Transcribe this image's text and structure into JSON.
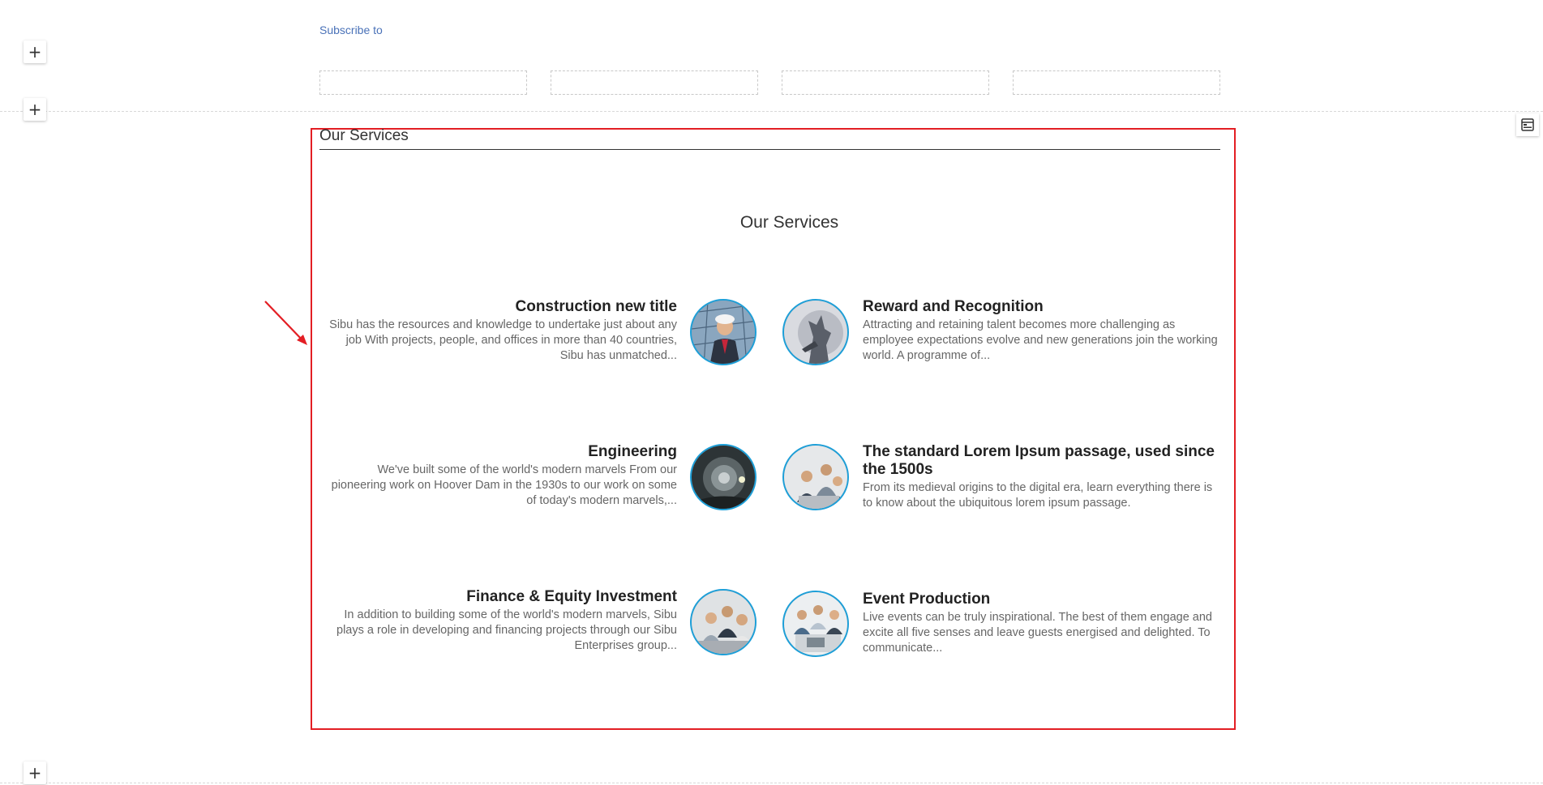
{
  "subscribe": {
    "label": "Subscribe to"
  },
  "section": {
    "header_title": "Our Services",
    "center_title": "Our Services"
  },
  "services": [
    {
      "title": "Construction new title",
      "desc": "Sibu has the resources and knowledge to undertake just about any job With projects, people, and offices in more than 40 countries, Sibu has unmatched...",
      "image": "man-in-hardhat-photo"
    },
    {
      "title": "Reward and Recognition",
      "desc": "Attracting and retaining talent becomes more challenging as employee expectations evolve and new generations join the working world. A programme of...",
      "image": "statue-photo"
    },
    {
      "title": "Engineering",
      "desc": "We've built some of the world's modern marvels From our pioneering work on Hoover Dam in the 1930s to our work on some of today's modern marvels,...",
      "image": "tunnel-photo"
    },
    {
      "title": "The standard Lorem Ipsum passage, used since the 1500s",
      "desc": "From its medieval origins to the digital era, learn everything there is to know about the ubiquitous lorem ipsum passage.",
      "image": "office-team-photo"
    },
    {
      "title": "Finance & Equity Investment",
      "desc": "In addition to building some of the world's modern marvels, Sibu plays a role in developing and financing projects through our Sibu Enterprises group...",
      "image": "business-meeting-photo"
    },
    {
      "title": "Event Production",
      "desc": "Live events can be truly inspirational. The best of them engage and excite all five senses and leave guests energised and delighted. To communicate...",
      "image": "laptop-team-photo"
    }
  ],
  "colors": {
    "accent": "#1d9fd8",
    "highlight": "#e31e24",
    "link": "#4a72b8"
  }
}
